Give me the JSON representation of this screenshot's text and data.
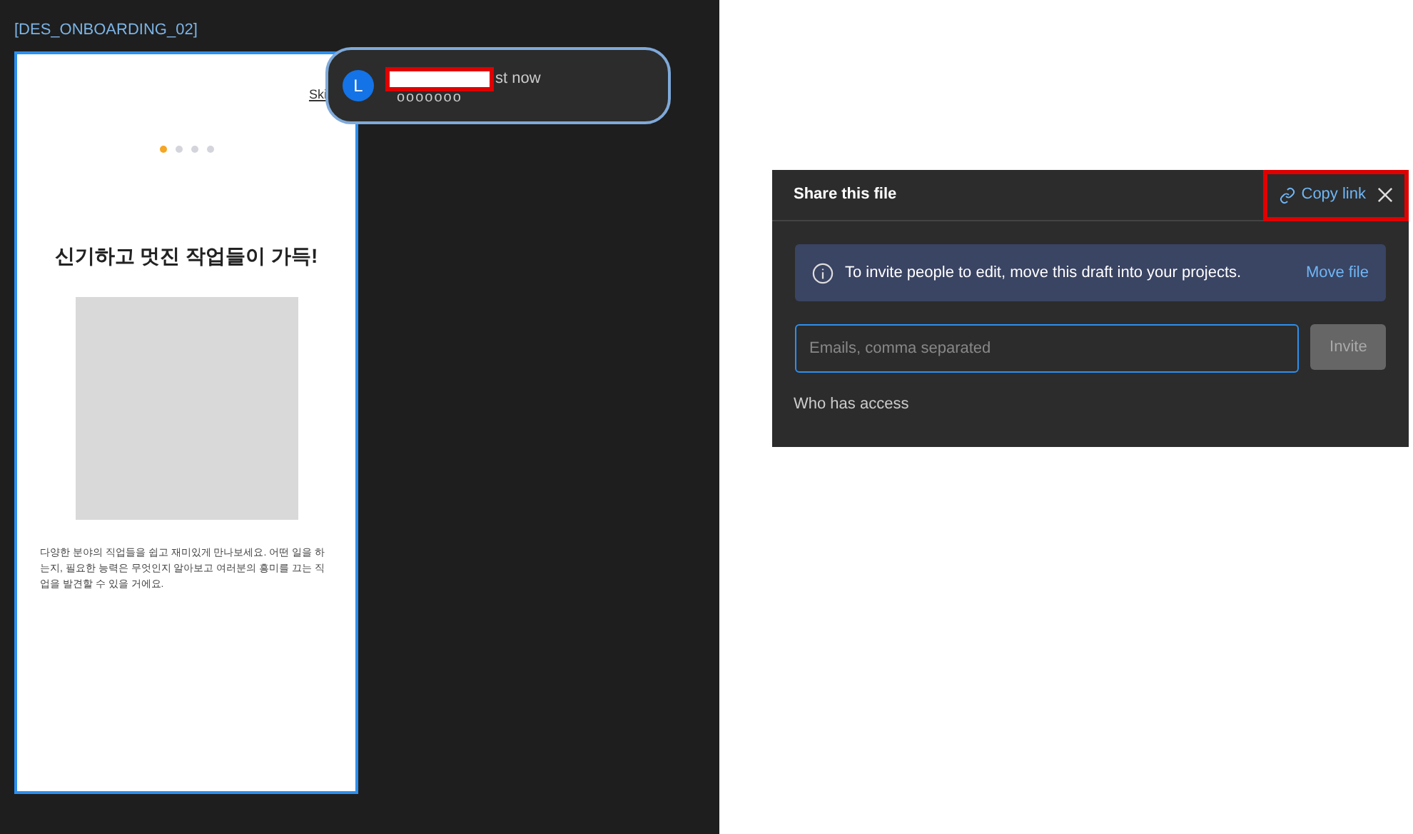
{
  "frame": {
    "title": "[DES_ONBOARDING_02]",
    "skip": "Ski",
    "dots": [
      {
        "selected": true
      },
      {
        "selected": false
      },
      {
        "selected": false
      },
      {
        "selected": false
      }
    ],
    "heading": "신기하고 멋진 작업들이 가득!",
    "image": {
      "kind": "placeholder"
    },
    "body": "다양한 분야의 직업들을 쉽고 재미있게 만나보세요. 어떤 일을 하는지, 필요한 능력은 무엇인지 알아보고 여러분의 흥미를 끄는 직업을 발견할 수 있을 거에요."
  },
  "notification": {
    "avatar": "L",
    "time": "st now",
    "message": "ooooooo",
    "redacted": true
  },
  "share_dialog": {
    "title": "Share this file",
    "copy_link": "Copy link",
    "highlighted": true,
    "notice": "To invite people to edit, move this draft into your projects.",
    "notice_action": "Move file",
    "email_field": {
      "placeholder": "Emails, comma separated"
    },
    "invite_button": {
      "label": "Invite",
      "disabled": true
    },
    "access_heading": "Who has access"
  }
}
